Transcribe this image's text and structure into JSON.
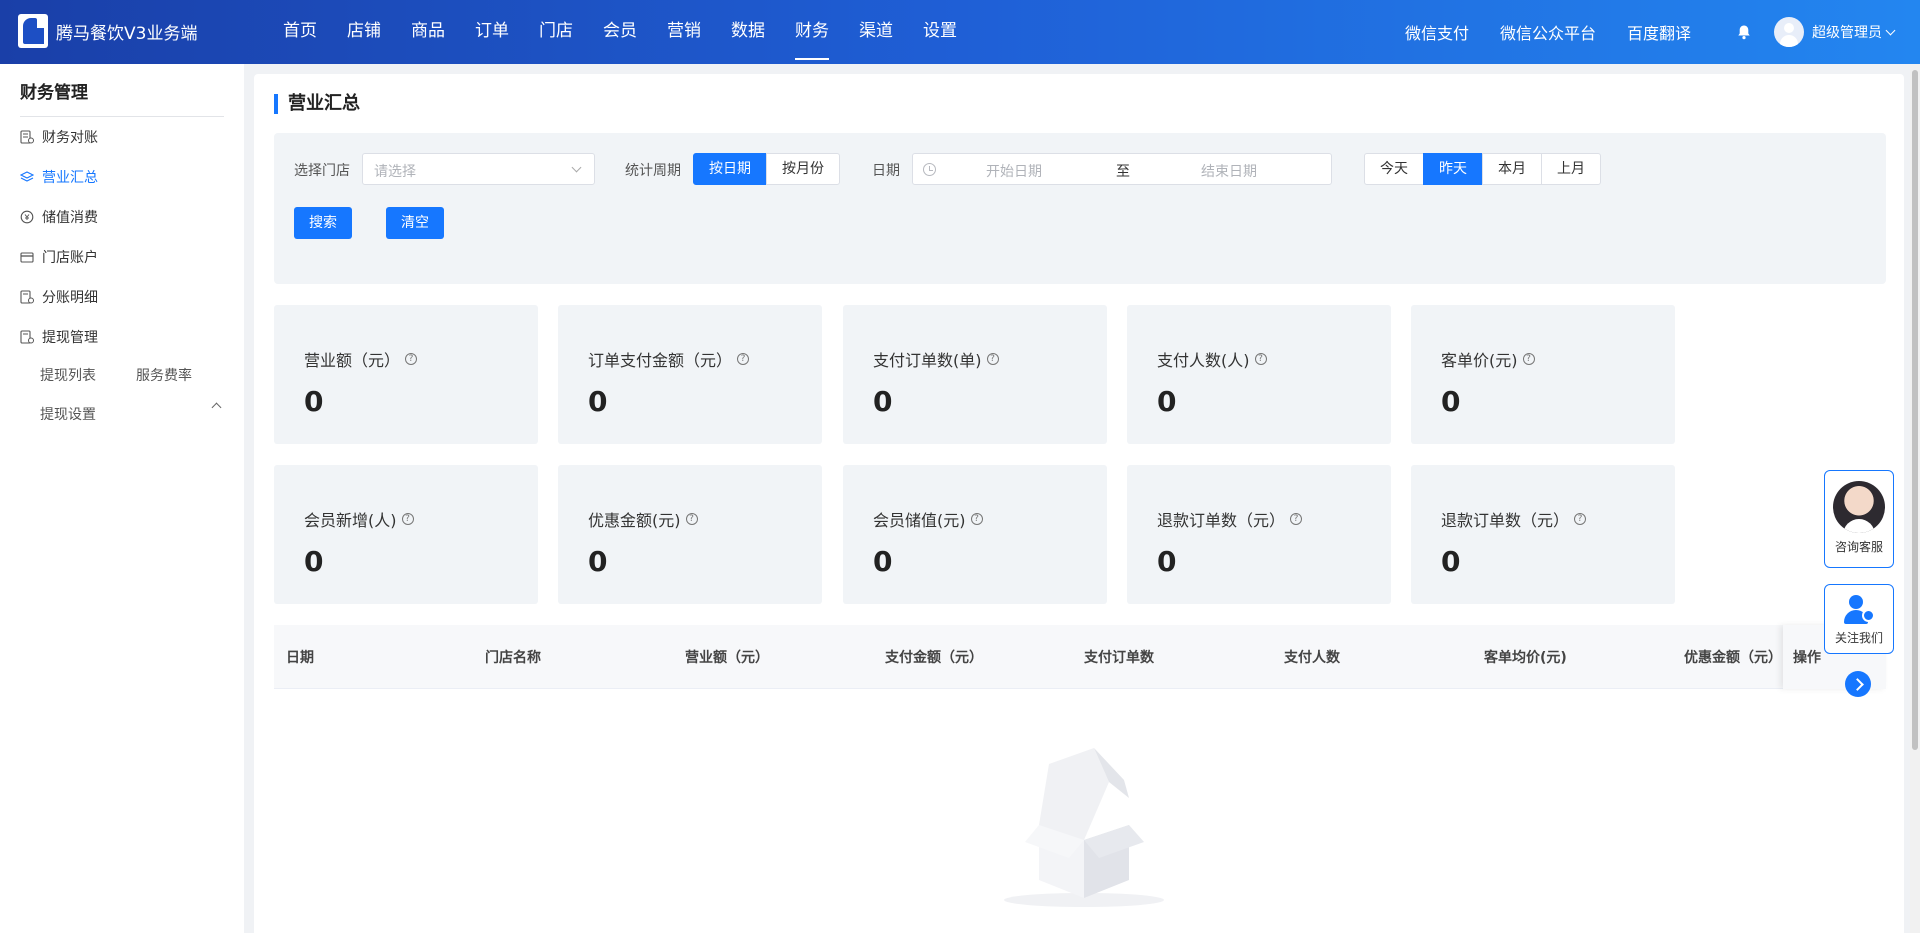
{
  "header": {
    "brand": "腾马餐饮V3业务端",
    "nav": [
      "首页",
      "店铺",
      "商品",
      "订单",
      "门店",
      "会员",
      "营销",
      "数据",
      "财务",
      "渠道",
      "设置"
    ],
    "active_nav": "财务",
    "links": [
      "微信支付",
      "微信公众平台",
      "百度翻译"
    ],
    "user": "超级管理员",
    "accent": "#1677ff"
  },
  "sidebar": {
    "title": "财务管理",
    "items": [
      {
        "label": "财务对账",
        "icon": "ledger-icon"
      },
      {
        "label": "营业汇总",
        "icon": "layers-icon",
        "active": true
      },
      {
        "label": "储值消费",
        "icon": "coin-icon"
      },
      {
        "label": "门店账户",
        "icon": "card-icon"
      },
      {
        "label": "分账明细",
        "icon": "split-icon"
      },
      {
        "label": "提现管理",
        "icon": "withdraw-icon",
        "expanded": true
      }
    ],
    "sub_items": [
      "提现列表",
      "服务费率",
      "提现设置"
    ]
  },
  "page": {
    "title": "营业汇总",
    "filters": {
      "store_label": "选择门店",
      "store_placeholder": "请选择",
      "period_label": "统计周期",
      "period_options": [
        "按日期",
        "按月份"
      ],
      "date_label": "日期",
      "start_placeholder": "开始日期",
      "range_sep": "至",
      "end_placeholder": "结束日期",
      "quick": [
        "今天",
        "昨天",
        "本月",
        "上月"
      ],
      "quick_active": "昨天",
      "search": "搜索",
      "clear": "清空"
    },
    "stats_row1": [
      {
        "label": "营业额（元）",
        "value": "0"
      },
      {
        "label": "订单支付金额（元）",
        "value": "0"
      },
      {
        "label": "支付订单数(单)",
        "value": "0"
      },
      {
        "label": "支付人数(人)",
        "value": "0"
      },
      {
        "label": "客单价(元)",
        "value": "0"
      }
    ],
    "stats_row2": [
      {
        "label": "会员新增(人)",
        "value": "0"
      },
      {
        "label": "优惠金额(元)",
        "value": "0"
      },
      {
        "label": "会员储值(元)",
        "value": "0"
      },
      {
        "label": "退款订单数（元）",
        "value": "0"
      },
      {
        "label": "退款订单数（元）",
        "value": "0"
      }
    ],
    "table_headers": [
      "日期",
      "门店名称",
      "营业额（元）",
      "支付金额（元）",
      "支付订单数",
      "支付人数",
      "客单均价(元)",
      "优惠金额（元）",
      "操作"
    ]
  },
  "floating": {
    "consult": "咨询客服",
    "follow": "关注我们"
  }
}
